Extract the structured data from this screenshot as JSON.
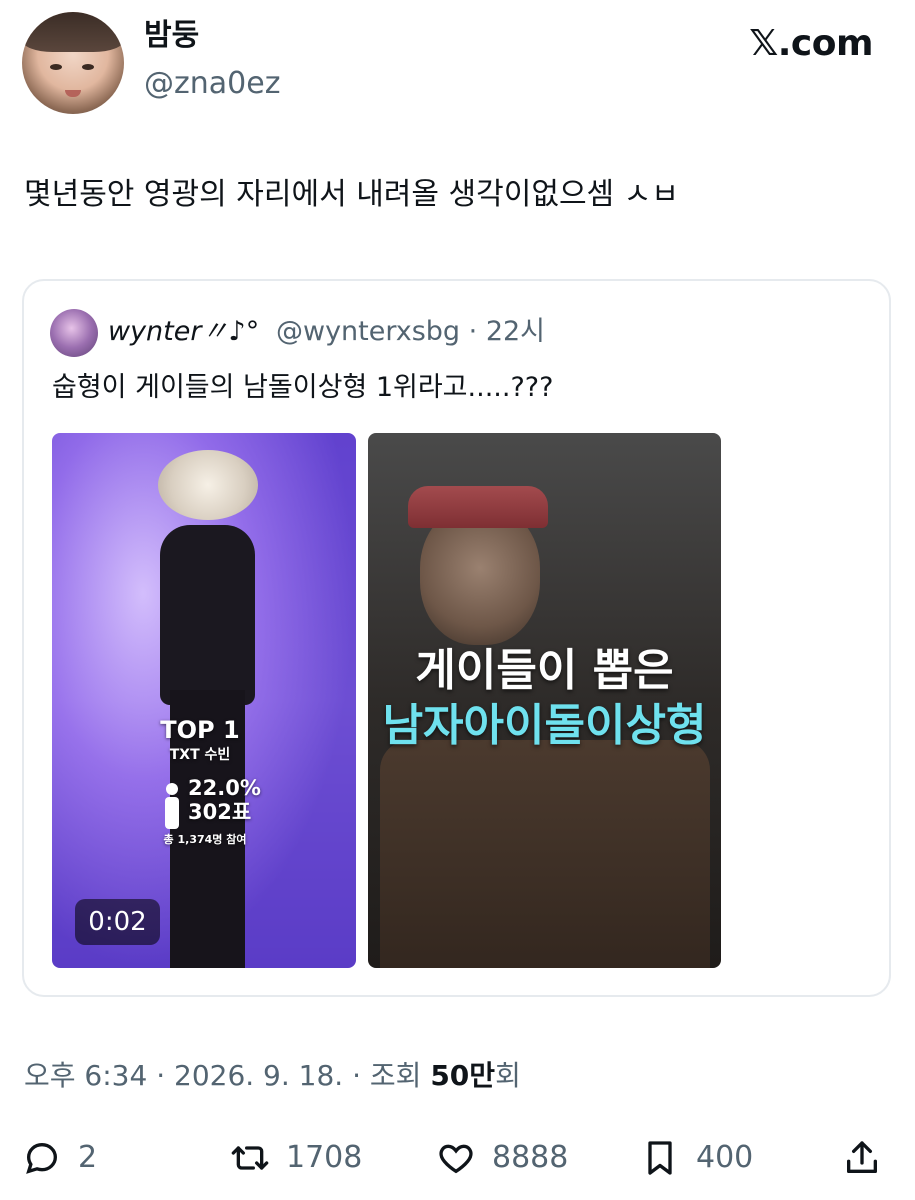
{
  "author": {
    "display_name": "밤둥",
    "handle": "@zna0ez"
  },
  "brand": "𝕏.com",
  "tweet_text": "몇년동안 영광의 자리에서 내려올 생각이없으셈 ㅅㅂ",
  "quoted": {
    "display_name": "wynter〃♪°",
    "handle_time": "@wynterxsbg · 22시",
    "text": "숩형이 게이들의 남돌이상형 1위라고.....???",
    "media": [
      {
        "overlay_rank": "TOP 1",
        "overlay_name": "TXT 수빈",
        "overlay_percent": "22.0%",
        "overlay_votes": "302표",
        "overlay_total": "총 1,374명 참여",
        "duration": "0:02"
      },
      {
        "overlay_line1": "게이들이 뽑은",
        "overlay_line2": "남자아이돌이상형"
      }
    ]
  },
  "meta": {
    "time_date": "오후 6:34 · 2026. 9. 18. · 조회 ",
    "views": "50만",
    "views_suffix": "회"
  },
  "actions": {
    "replies": "2",
    "retweets": "1708",
    "likes": "8888",
    "bookmarks": "400"
  },
  "icons": [
    "reply-icon",
    "retweet-icon",
    "like-icon",
    "bookmark-icon",
    "share-icon"
  ]
}
